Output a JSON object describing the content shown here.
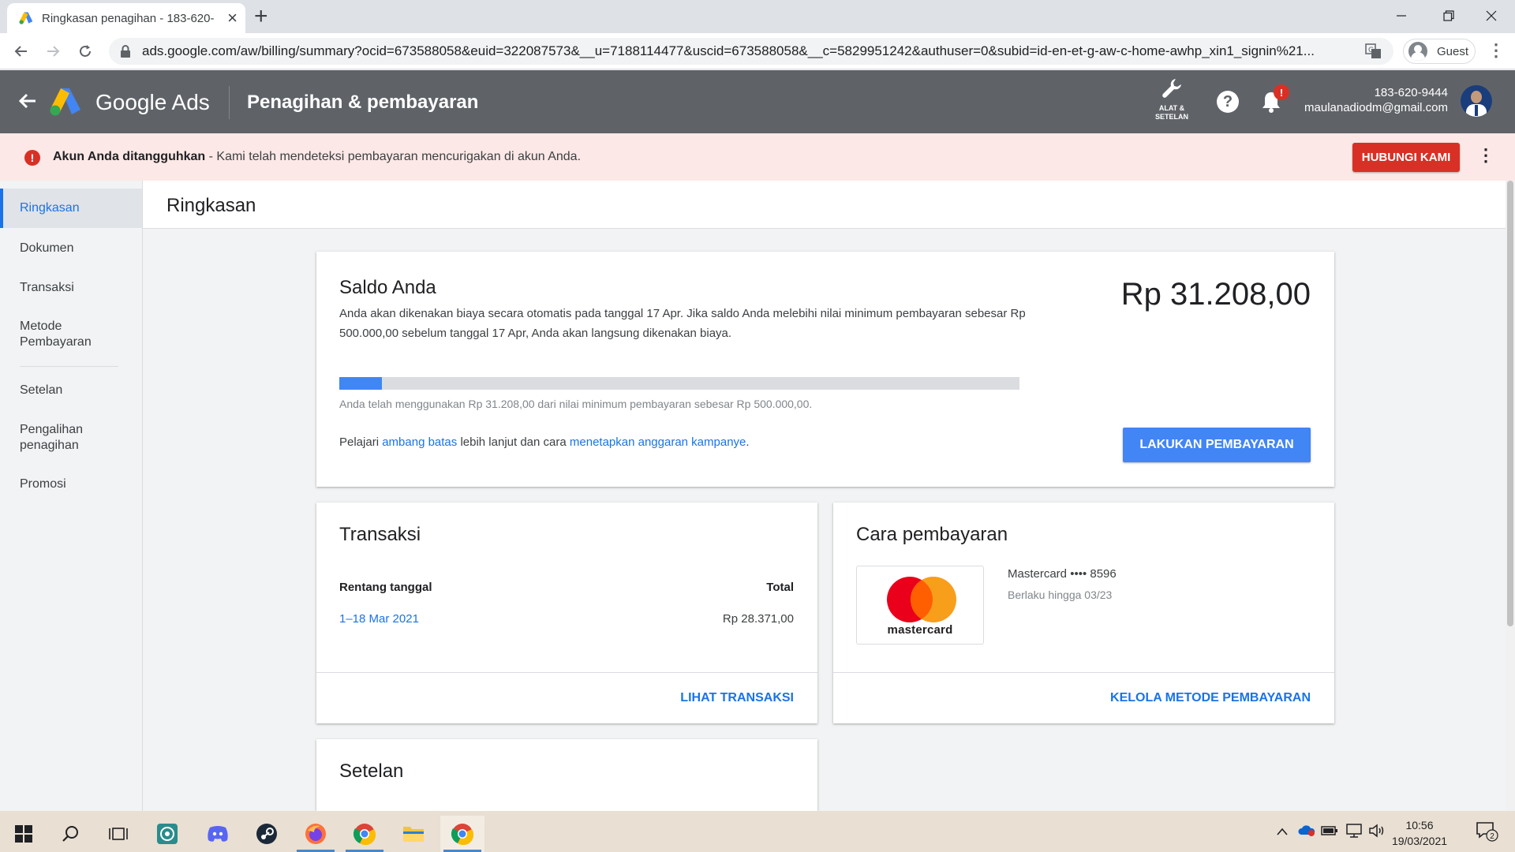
{
  "browser": {
    "tab_title": "Ringkasan penagihan - 183-620-",
    "url": "ads.google.com/aw/billing/summary?ocid=673588058&euid=322087573&__u=7188114477&uscid=673588058&__c=5829951242&authuser=0&subid=id-en-et-g-aw-c-home-awhp_xin1_signin%21...",
    "profile_label": "Guest"
  },
  "header": {
    "product": "Google Ads",
    "page_title": "Penagihan & pembayaran",
    "tools_label_1": "ALAT &",
    "tools_label_2": "SETELAN",
    "notification_badge": "!",
    "account_id": "183-620-9444",
    "account_email": "maulanadiodm@gmail.com"
  },
  "alert": {
    "title": "Akun Anda ditangguhkan",
    "message": " - Kami telah mendeteksi pembayaran mencurigakan di akun Anda.",
    "button": "HUBUNGI KAMI"
  },
  "sidebar": {
    "items": [
      {
        "label": "Ringkasan"
      },
      {
        "label": "Dokumen"
      },
      {
        "label": "Transaksi"
      },
      {
        "label": "Metode Pembayaran"
      },
      {
        "label": "Setelan"
      },
      {
        "label": "Pengalihan penagihan"
      },
      {
        "label": "Promosi"
      }
    ]
  },
  "main": {
    "title": "Ringkasan",
    "balance": {
      "heading": "Saldo Anda",
      "description": "Anda akan dikenakan biaya secara otomatis pada tanggal 17 Apr. Jika saldo Anda melebihi nilai minimum pembayaran sebesar Rp 500.000,00 sebelum tanggal 17 Apr, Anda akan langsung dikenakan biaya.",
      "amount": "Rp 31.208,00",
      "progress_fraction": 0.0624,
      "progress_note": "Anda telah menggunakan Rp 31.208,00 dari nilai minimum pembayaran sebesar Rp 500.000,00.",
      "learn_prefix": "Pelajari ",
      "learn_link1": "ambang batas",
      "learn_mid": " lebih lanjut dan cara ",
      "learn_link2": "menetapkan anggaran kampanye",
      "learn_suffix": ".",
      "pay_button": "LAKUKAN PEMBAYARAN"
    },
    "transactions": {
      "heading": "Transaksi",
      "col_date": "Rentang tanggal",
      "col_total": "Total",
      "row_date": "1–18 Mar 2021",
      "row_total": "Rp 28.371,00",
      "footer_link": "LIHAT TRANSAKSI"
    },
    "payment_method": {
      "heading": "Cara pembayaran",
      "logo_text": "mastercard",
      "card_name": "Mastercard •••• 8596",
      "expiry": "Berlaku hingga 03/23",
      "footer_link": "KELOLA METODE PEMBAYARAN"
    },
    "settings": {
      "heading": "Setelan"
    }
  },
  "taskbar": {
    "time": "10:56",
    "date": "19/03/2021",
    "notification_count": "2"
  },
  "colors": {
    "header_bg": "#5f6368",
    "alert_bg": "#fce8e6",
    "alert_red": "#d93025",
    "accent_blue": "#1a73e8",
    "button_blue": "#4285f4"
  }
}
